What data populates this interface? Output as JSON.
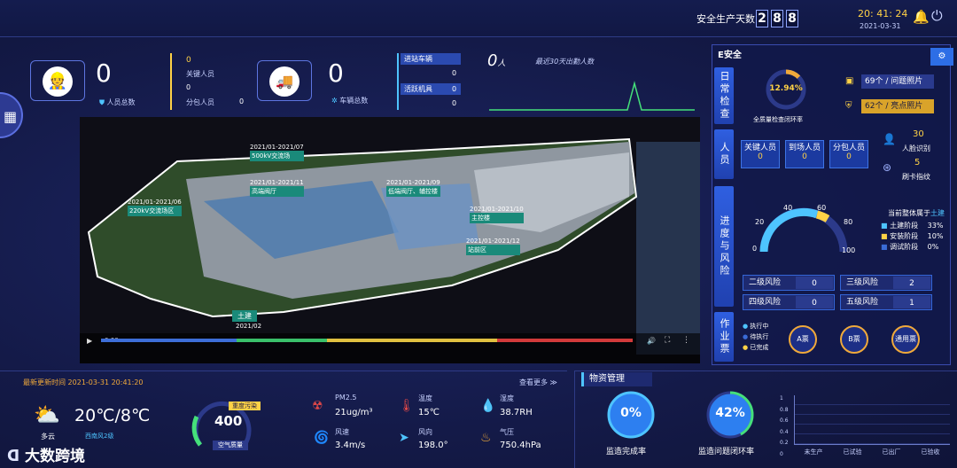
{
  "header": {
    "safety_days_label": "安全生产天数",
    "safety_days": [
      "2",
      "8",
      "8"
    ],
    "time": "20: 41: 24",
    "date": "2021-03-31"
  },
  "stats": {
    "people_total": "0",
    "people_total_label": "人员总数",
    "key_person_label": "关键人员",
    "key_person_val": "0",
    "sub_person_label": "分包人员",
    "sub_person_val": "0",
    "sub_person_val2": "0",
    "vehicle_total": "0",
    "vehicle_total_label": "车辆总数",
    "enter_vehicle_label": "进站车辆",
    "enter_vehicle_val": "0",
    "machine_label": "活跃机具",
    "machine_val": "0",
    "machine_val2": "0",
    "attendance_val": "0",
    "attendance_unit": "人",
    "attendance_label": "最近30天出勤人数"
  },
  "map": {
    "labels": [
      {
        "date": "2021/01-2021/07",
        "name": "500kV交流场"
      },
      {
        "date": "2021/01-2021/11",
        "name": "高端阀厅"
      },
      {
        "date": "2021/01-2021/09",
        "name": "低端阀厅、辅控楼"
      },
      {
        "date": "2021/01-2021/06",
        "name": "220kV交流场区"
      },
      {
        "date": "2021/01-2021/10",
        "name": "主控楼"
      },
      {
        "date": "2021/01-2021/12",
        "name": "站前区"
      }
    ],
    "stage_label": "土建",
    "stage_date": "2021/02",
    "video_time": "0:00"
  },
  "right": {
    "title": "E安全",
    "tabs": [
      "日常检查",
      "人员",
      "进度与风险",
      "作业票"
    ],
    "closure_rate": "12.94%",
    "closure_label": "全质量检查闭环率",
    "issue_photos": "69个 / 问题照片",
    "highlight_photos": "62个 / 亮点照片",
    "persons": [
      {
        "label": "关键人员",
        "val": "0"
      },
      {
        "label": "到场人员",
        "val": "0"
      },
      {
        "label": "分包人员",
        "val": "0"
      }
    ],
    "face_val": "30",
    "face_label": "人脸识别",
    "finger_val": "5",
    "finger_label": "刷卡指纹",
    "gauge_ticks": [
      "20",
      "40",
      "60",
      "80",
      "100",
      "0"
    ],
    "stage_title": "当前整体属于",
    "stage_name": "土建",
    "stages": [
      {
        "label": "土建阶段",
        "pct": "33%",
        "color": "#4ec4ff"
      },
      {
        "label": "安装阶段",
        "pct": "10%",
        "color": "#ffd246"
      },
      {
        "label": "调试阶段",
        "pct": "0%",
        "color": "#3a6bd6"
      }
    ],
    "risks": [
      {
        "label": "二级风险",
        "val": "0"
      },
      {
        "label": "三级风险",
        "val": "2"
      },
      {
        "label": "四级风险",
        "val": "0"
      },
      {
        "label": "五级风险",
        "val": "1"
      }
    ],
    "ticket_legend": [
      "执行中",
      "待执行",
      "已完成"
    ],
    "tickets": [
      "A票",
      "B票",
      "通用票"
    ]
  },
  "weather": {
    "update_label": "最新更新时间",
    "update_time": "2021-03-31 20:41:20",
    "more": "查看更多",
    "temp": "20℃/8℃",
    "cond": "多云",
    "wind_desc": "西南风2级",
    "aqi": "400",
    "aqi_level": "重度污染",
    "aqi_label": "空气质量",
    "pm25_label": "PM2.5",
    "pm25": "21ug/m³",
    "temp_label": "温度",
    "temp_val": "15℃",
    "hum_label": "湿度",
    "hum": "38.7RH",
    "wspd_label": "风速",
    "wspd": "3.4m/s",
    "wdir_label": "风向",
    "wdir": "198.0°",
    "press_label": "气压",
    "press": "750.4hPa"
  },
  "materials": {
    "title": "物资管理",
    "supervise_rate": "0%",
    "supervise_label": "监造完成率",
    "issue_rate": "42%",
    "issue_label": "监造问题闭环率",
    "yticks": [
      "1",
      "0.8",
      "0.6",
      "0.4",
      "0.2",
      "0"
    ],
    "categories": [
      "未生产",
      "已试验",
      "已出厂",
      "已验收"
    ]
  },
  "watermark": "大数跨境"
}
